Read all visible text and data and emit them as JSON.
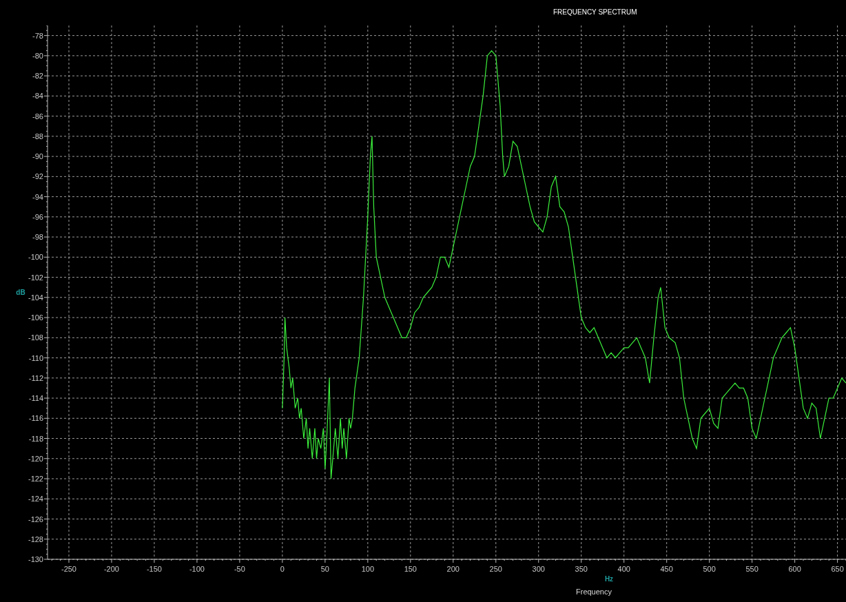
{
  "chart": {
    "x_unit": "Hz",
    "chart_data": {
      "type": "line",
      "title": "FREQUENCY SPECTRUM",
      "xlabel": "Frequency",
      "ylabel": "dB",
      "x": [
        0,
        2,
        3,
        5,
        8,
        10,
        12,
        15,
        18,
        20,
        22,
        25,
        28,
        30,
        32,
        35,
        38,
        40,
        42,
        45,
        48,
        50,
        52,
        55,
        57,
        60,
        62,
        65,
        68,
        70,
        72,
        75,
        78,
        80,
        82,
        85,
        90,
        95,
        100,
        103,
        105,
        107,
        110,
        115,
        120,
        125,
        130,
        135,
        140,
        145,
        150,
        155,
        160,
        165,
        170,
        175,
        180,
        185,
        190,
        195,
        200,
        205,
        210,
        215,
        220,
        225,
        230,
        235,
        240,
        245,
        250,
        255,
        258,
        260,
        265,
        270,
        275,
        280,
        285,
        290,
        295,
        300,
        305,
        310,
        315,
        320,
        325,
        330,
        335,
        340,
        345,
        350,
        355,
        360,
        365,
        370,
        375,
        380,
        385,
        390,
        395,
        400,
        405,
        410,
        415,
        420,
        425,
        430,
        435,
        440,
        443,
        448,
        453,
        460,
        465,
        470,
        475,
        480,
        485,
        490,
        495,
        500,
        505,
        510,
        515,
        520,
        525,
        530,
        535,
        540,
        545,
        550,
        555,
        560,
        565,
        570,
        575,
        580,
        585,
        590,
        595,
        600,
        605,
        610,
        615,
        620,
        625,
        630,
        635,
        640,
        645,
        650,
        655,
        660
      ],
      "series": [
        {
          "color": "#3cf03c",
          "values": [
            -115,
            -110,
            -106,
            -109,
            -111,
            -113,
            -112,
            -115,
            -114,
            -116,
            -115,
            -118,
            -116,
            -119,
            -117,
            -120,
            -117,
            -120,
            -118,
            -119,
            -117,
            -121,
            -118,
            -112,
            -122,
            -119,
            -117,
            -120,
            -116,
            -119,
            -117,
            -120,
            -116,
            -117,
            -116,
            -113,
            -110,
            -104,
            -96,
            -90,
            -88,
            -95,
            -100,
            -102,
            -104,
            -105,
            -106,
            -107,
            -108,
            -108,
            -107,
            -105.5,
            -105,
            -104,
            -103.5,
            -103,
            -102,
            -100,
            -100,
            -101,
            -99,
            -97,
            -95,
            -93,
            -91,
            -90,
            -87,
            -84,
            -80,
            -79.5,
            -80,
            -85,
            -90,
            -92,
            -91,
            -88.5,
            -89,
            -91,
            -93,
            -95,
            -96.5,
            -97,
            -97.5,
            -96,
            -93,
            -92,
            -95,
            -95.5,
            -97,
            -100,
            -103,
            -106,
            -107,
            -107.5,
            -107,
            -108,
            -109,
            -110,
            -109.5,
            -110,
            -109.5,
            -109,
            -109,
            -108.5,
            -108,
            -109,
            -110,
            -112.5,
            -108,
            -104,
            -103,
            -107,
            -108,
            -108.5,
            -110,
            -114,
            -116,
            -118,
            -119,
            -116,
            -115.5,
            -115,
            -116.5,
            -117,
            -114,
            -113.5,
            -113,
            -112.5,
            -113,
            -113,
            -114,
            -117,
            -118,
            -116,
            -114,
            -112,
            -110,
            -109,
            -108,
            -107.5,
            -107,
            -109,
            -112,
            -115,
            -116,
            -114.5,
            -115,
            -118,
            -116,
            -114,
            -114,
            -113,
            -112,
            -112.5
          ]
        }
      ],
      "grid": true,
      "xlim": [
        -275,
        660
      ],
      "ylim": [
        -130,
        -77
      ],
      "xticks": [
        -250,
        -200,
        -150,
        -100,
        -50,
        0,
        50,
        100,
        150,
        200,
        250,
        300,
        350,
        400,
        450,
        500,
        550,
        600,
        650
      ],
      "yticks": [
        -78,
        -80,
        -82,
        -84,
        -86,
        -88,
        -90,
        -92,
        -94,
        -96,
        -98,
        -100,
        -102,
        -104,
        -106,
        -108,
        -110,
        -112,
        -114,
        -116,
        -118,
        -120,
        -122,
        -124,
        -126,
        -128,
        -130
      ]
    }
  }
}
